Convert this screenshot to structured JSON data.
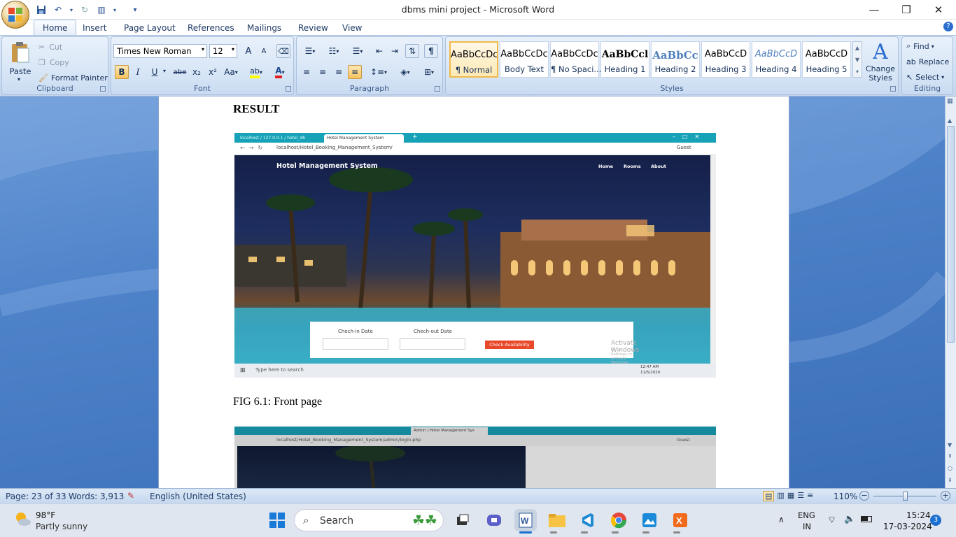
{
  "window": {
    "title": "dbms mini project - Microsoft Word"
  },
  "tabs": [
    "Home",
    "Insert",
    "Page Layout",
    "References",
    "Mailings",
    "Review",
    "View"
  ],
  "clipboard": {
    "paste": "Paste",
    "cut": "Cut",
    "copy": "Copy",
    "format_painter": "Format Painter",
    "label": "Clipboard"
  },
  "font": {
    "name": "Times New Roman",
    "size": "12",
    "label": "Font",
    "bold": "B",
    "italic": "I",
    "underline": "U",
    "strike": "abe",
    "subscript": "x₂",
    "superscript": "x²",
    "change_case": "Aa",
    "grow": "A",
    "shrink": "A"
  },
  "paragraph": {
    "label": "Paragraph"
  },
  "styles": {
    "label": "Styles",
    "items": [
      {
        "sample": "AaBbCcDc",
        "name": "¶ Normal"
      },
      {
        "sample": "AaBbCcDc",
        "name": "Body Text"
      },
      {
        "sample": "AaBbCcDc",
        "name": "¶ No Spaci..."
      },
      {
        "sample": "AaBbCcl",
        "name": "Heading 1"
      },
      {
        "sample": "AaBbCc",
        "name": "Heading 2"
      },
      {
        "sample": "AaBbCcD",
        "name": "Heading 3"
      },
      {
        "sample": "AaBbCcD",
        "name": "Heading 4"
      },
      {
        "sample": "AaBbCcD",
        "name": "Heading 5"
      }
    ],
    "change_styles": "Change Styles"
  },
  "editing": {
    "label": "Editing",
    "find": "Find",
    "replace": "Replace",
    "select": "Select"
  },
  "document": {
    "heading": "RESULT",
    "caption": "FIG 6.1: Front page",
    "screenshot1": {
      "tab1": "localhost / 127.0.0.1 / hotel_db",
      "tab2": "Hotel Management System",
      "url": "localhost/Hotel_Booking_Management_System/",
      "guest": "Guest",
      "site_title": "Hotel Management System",
      "nav": [
        "Home",
        "Rooms",
        "About"
      ],
      "checkin": "Chech-in Date",
      "checkout": "Chech-out Date",
      "check_btn": "Check Availability",
      "activate": "Activate Windows",
      "activate_sub": "Go to Settings to activate Windows.",
      "taskbar_search": "Type here to search",
      "clock_time": "12:47 AM",
      "clock_date": "11/5/2020"
    },
    "screenshot2": {
      "url": "localhost/Hotel_Booking_Management_System/admin/login.php",
      "tab3": "Admin | Hotel Management Sys",
      "guest": "Guest"
    }
  },
  "status": {
    "page": "Page: 23 of 33",
    "words": "Words: 3,913",
    "language": "English (United States)",
    "zoom": "110%"
  },
  "taskbar": {
    "weather_temp": "98°F",
    "weather_desc": "Partly sunny",
    "search": "Search",
    "lang1": "ENG",
    "lang2": "IN",
    "time": "15:24",
    "date": "17-03-2024",
    "notif_count": "3"
  }
}
